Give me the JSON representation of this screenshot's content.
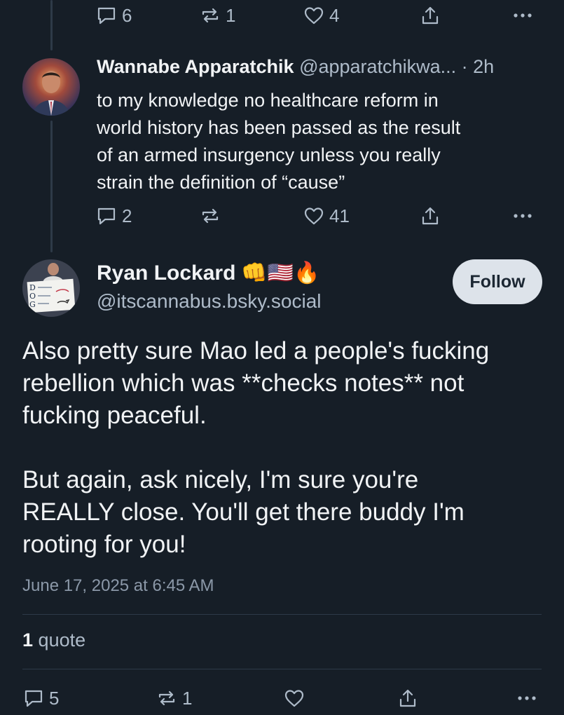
{
  "top_actions": {
    "reply_count": "6",
    "repost_count": "1",
    "like_count": "4"
  },
  "reply": {
    "display_name": "Wannabe Apparatchik",
    "handle": "@apparatchikwa...",
    "time": "· 2h",
    "text": "to my knowledge no healthcare reform in\nworld history has been passed as the result\nof an armed insurgency unless you really\nstrain the definition of “cause”",
    "actions": {
      "reply_count": "2",
      "repost_count": "",
      "like_count": "41"
    }
  },
  "post": {
    "display_name": "Ryan Lockard",
    "emoji": "👊🇺🇸🔥",
    "handle": "@itscannabus.bsky.social",
    "follow_label": "Follow",
    "text": "Also pretty sure Mao led a people's fucking\nrebellion which was **checks notes** not\nfucking peaceful.\n\nBut again, ask nicely, I'm sure you're\nREALLY close. You'll get there buddy I'm\nrooting for you!",
    "timestamp": "June 17, 2025 at 6:45 AM",
    "quote_count": "1",
    "quote_label": "quote",
    "actions": {
      "reply_count": "5",
      "repost_count": "1"
    }
  },
  "colors": {
    "background": "#161e27",
    "text": "#f1f3f5",
    "muted": "#aebbc9",
    "follow_bg": "#dde3ea"
  }
}
